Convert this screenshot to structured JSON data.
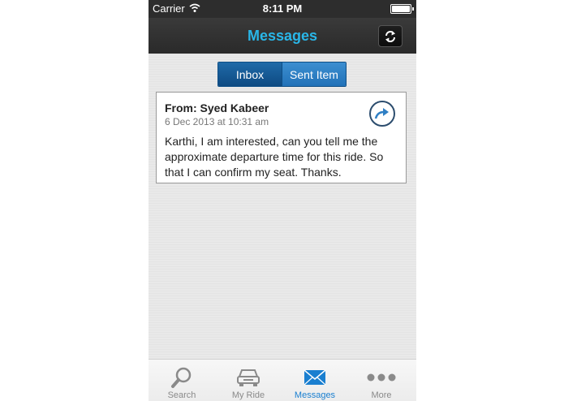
{
  "status_bar": {
    "carrier": "Carrier",
    "time": "8:11 PM"
  },
  "nav": {
    "title": "Messages",
    "refresh_icon": "refresh-icon"
  },
  "segments": {
    "inbox": "Inbox",
    "sent": "Sent Item",
    "selected": "Inbox"
  },
  "message": {
    "from": "From: Syed Kabeer",
    "date": "6 Dec 2013 at 10:31 am",
    "body": "Karthi, I am interested, can you tell me the approximate departure time for this ride. So that I can confirm my seat. Thanks.",
    "forward_icon": "forward-icon"
  },
  "tabs": [
    {
      "label": "Search",
      "icon": "search-icon"
    },
    {
      "label": "My Ride",
      "icon": "car-icon"
    },
    {
      "label": "Messages",
      "icon": "envelope-icon",
      "active": true
    },
    {
      "label": "More",
      "icon": "more-icon"
    }
  ],
  "colors": {
    "accent": "#29b6e8",
    "tab_active": "#1a7fd0",
    "segment_selected": "#0e4a82"
  }
}
